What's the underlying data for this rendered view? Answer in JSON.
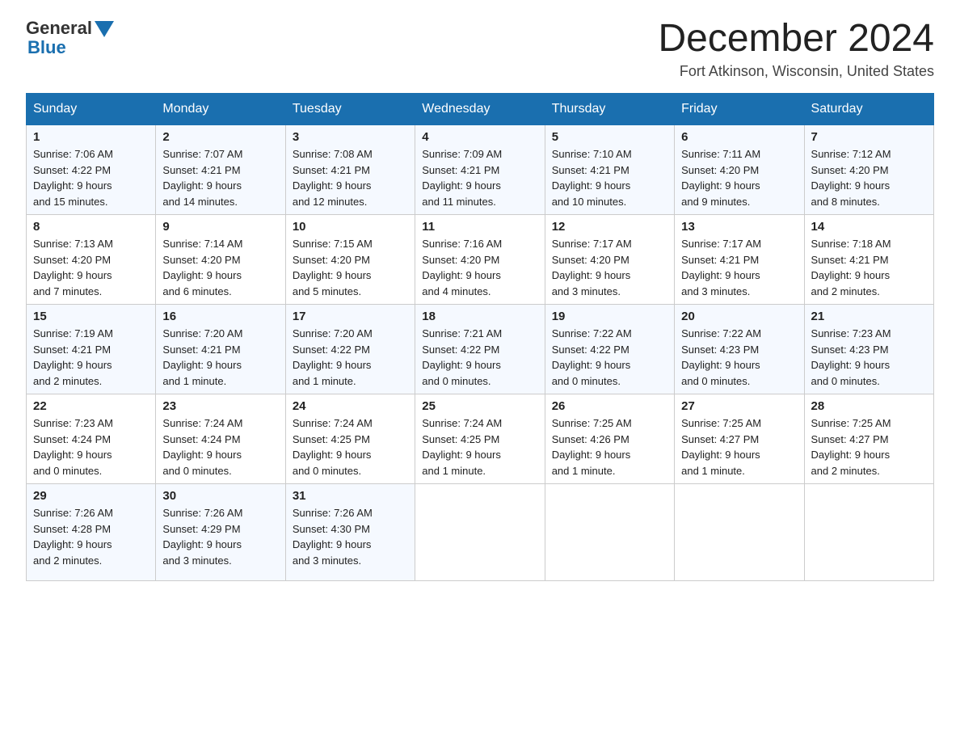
{
  "header": {
    "logo_general": "General",
    "logo_blue": "Blue",
    "month_title": "December 2024",
    "location": "Fort Atkinson, Wisconsin, United States"
  },
  "weekdays": [
    "Sunday",
    "Monday",
    "Tuesday",
    "Wednesday",
    "Thursday",
    "Friday",
    "Saturday"
  ],
  "weeks": [
    [
      {
        "day": "1",
        "sunrise": "7:06 AM",
        "sunset": "4:22 PM",
        "daylight": "9 hours and 15 minutes."
      },
      {
        "day": "2",
        "sunrise": "7:07 AM",
        "sunset": "4:21 PM",
        "daylight": "9 hours and 14 minutes."
      },
      {
        "day": "3",
        "sunrise": "7:08 AM",
        "sunset": "4:21 PM",
        "daylight": "9 hours and 12 minutes."
      },
      {
        "day": "4",
        "sunrise": "7:09 AM",
        "sunset": "4:21 PM",
        "daylight": "9 hours and 11 minutes."
      },
      {
        "day": "5",
        "sunrise": "7:10 AM",
        "sunset": "4:21 PM",
        "daylight": "9 hours and 10 minutes."
      },
      {
        "day": "6",
        "sunrise": "7:11 AM",
        "sunset": "4:20 PM",
        "daylight": "9 hours and 9 minutes."
      },
      {
        "day": "7",
        "sunrise": "7:12 AM",
        "sunset": "4:20 PM",
        "daylight": "9 hours and 8 minutes."
      }
    ],
    [
      {
        "day": "8",
        "sunrise": "7:13 AM",
        "sunset": "4:20 PM",
        "daylight": "9 hours and 7 minutes."
      },
      {
        "day": "9",
        "sunrise": "7:14 AM",
        "sunset": "4:20 PM",
        "daylight": "9 hours and 6 minutes."
      },
      {
        "day": "10",
        "sunrise": "7:15 AM",
        "sunset": "4:20 PM",
        "daylight": "9 hours and 5 minutes."
      },
      {
        "day": "11",
        "sunrise": "7:16 AM",
        "sunset": "4:20 PM",
        "daylight": "9 hours and 4 minutes."
      },
      {
        "day": "12",
        "sunrise": "7:17 AM",
        "sunset": "4:20 PM",
        "daylight": "9 hours and 3 minutes."
      },
      {
        "day": "13",
        "sunrise": "7:17 AM",
        "sunset": "4:21 PM",
        "daylight": "9 hours and 3 minutes."
      },
      {
        "day": "14",
        "sunrise": "7:18 AM",
        "sunset": "4:21 PM",
        "daylight": "9 hours and 2 minutes."
      }
    ],
    [
      {
        "day": "15",
        "sunrise": "7:19 AM",
        "sunset": "4:21 PM",
        "daylight": "9 hours and 2 minutes."
      },
      {
        "day": "16",
        "sunrise": "7:20 AM",
        "sunset": "4:21 PM",
        "daylight": "9 hours and 1 minute."
      },
      {
        "day": "17",
        "sunrise": "7:20 AM",
        "sunset": "4:22 PM",
        "daylight": "9 hours and 1 minute."
      },
      {
        "day": "18",
        "sunrise": "7:21 AM",
        "sunset": "4:22 PM",
        "daylight": "9 hours and 0 minutes."
      },
      {
        "day": "19",
        "sunrise": "7:22 AM",
        "sunset": "4:22 PM",
        "daylight": "9 hours and 0 minutes."
      },
      {
        "day": "20",
        "sunrise": "7:22 AM",
        "sunset": "4:23 PM",
        "daylight": "9 hours and 0 minutes."
      },
      {
        "day": "21",
        "sunrise": "7:23 AM",
        "sunset": "4:23 PM",
        "daylight": "9 hours and 0 minutes."
      }
    ],
    [
      {
        "day": "22",
        "sunrise": "7:23 AM",
        "sunset": "4:24 PM",
        "daylight": "9 hours and 0 minutes."
      },
      {
        "day": "23",
        "sunrise": "7:24 AM",
        "sunset": "4:24 PM",
        "daylight": "9 hours and 0 minutes."
      },
      {
        "day": "24",
        "sunrise": "7:24 AM",
        "sunset": "4:25 PM",
        "daylight": "9 hours and 0 minutes."
      },
      {
        "day": "25",
        "sunrise": "7:24 AM",
        "sunset": "4:25 PM",
        "daylight": "9 hours and 1 minute."
      },
      {
        "day": "26",
        "sunrise": "7:25 AM",
        "sunset": "4:26 PM",
        "daylight": "9 hours and 1 minute."
      },
      {
        "day": "27",
        "sunrise": "7:25 AM",
        "sunset": "4:27 PM",
        "daylight": "9 hours and 1 minute."
      },
      {
        "day": "28",
        "sunrise": "7:25 AM",
        "sunset": "4:27 PM",
        "daylight": "9 hours and 2 minutes."
      }
    ],
    [
      {
        "day": "29",
        "sunrise": "7:26 AM",
        "sunset": "4:28 PM",
        "daylight": "9 hours and 2 minutes."
      },
      {
        "day": "30",
        "sunrise": "7:26 AM",
        "sunset": "4:29 PM",
        "daylight": "9 hours and 3 minutes."
      },
      {
        "day": "31",
        "sunrise": "7:26 AM",
        "sunset": "4:30 PM",
        "daylight": "9 hours and 3 minutes."
      },
      null,
      null,
      null,
      null
    ]
  ],
  "labels": {
    "sunrise": "Sunrise:",
    "sunset": "Sunset:",
    "daylight": "Daylight:"
  }
}
